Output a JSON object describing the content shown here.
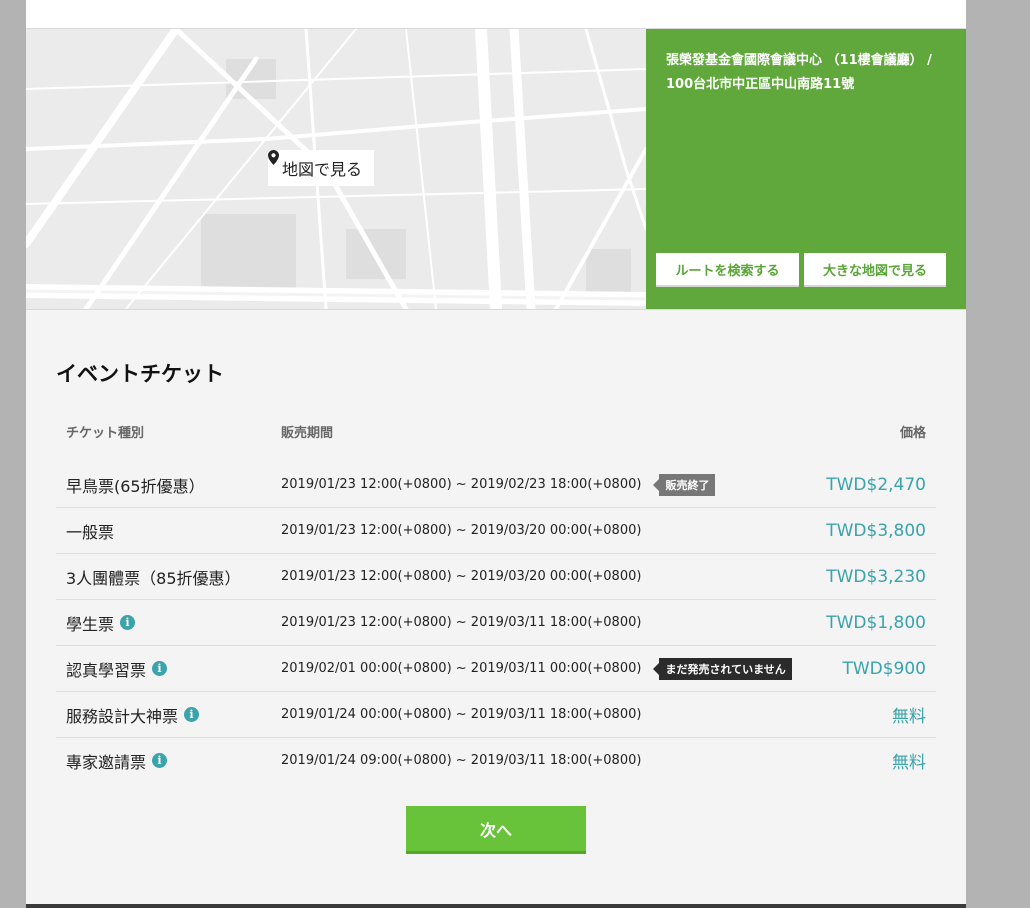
{
  "map": {
    "view_label": "地図で見る",
    "pin_icon": "map-pin-icon"
  },
  "venue": {
    "address": "張榮發基金會國際會議中心 （11樓會議廳） / 100台北市中正區中山南路11號",
    "route_button": "ルートを検索する",
    "large_map_button": "大きな地図で見る",
    "bg_color": "#60a83c"
  },
  "tickets": {
    "title": "イベントチケット",
    "headers": {
      "type": "チケット種別",
      "period": "販売期間",
      "price": "価格"
    },
    "rows": [
      {
        "name": "早鳥票(65折優惠）",
        "info": false,
        "period": "2019/01/23 12:00(+0800) ~ 2019/02/23 18:00(+0800)",
        "badge": "販売終了",
        "badge_style": "grey",
        "price": "TWD$2,470"
      },
      {
        "name": "一般票",
        "info": false,
        "period": "2019/01/23 12:00(+0800) ~ 2019/03/20 00:00(+0800)",
        "badge": "",
        "price": "TWD$3,800"
      },
      {
        "name": "3人團體票（85折優惠）",
        "info": false,
        "period": "2019/01/23 12:00(+0800) ~ 2019/03/20 00:00(+0800)",
        "badge": "",
        "price": "TWD$3,230"
      },
      {
        "name": "學生票",
        "info": true,
        "period": "2019/01/23 12:00(+0800) ~ 2019/03/11 18:00(+0800)",
        "badge": "",
        "price": "TWD$1,800"
      },
      {
        "name": "認真學習票",
        "info": true,
        "period": "2019/02/01 00:00(+0800) ~ 2019/03/11 00:00(+0800)",
        "badge": "まだ発売されていません",
        "badge_style": "dark",
        "price": "TWD$900"
      },
      {
        "name": "服務設計大神票",
        "info": true,
        "period": "2019/01/24 00:00(+0800) ~ 2019/03/11 18:00(+0800)",
        "badge": "",
        "price": "無料"
      },
      {
        "name": "專家邀請票",
        "info": true,
        "period": "2019/01/24 09:00(+0800) ~ 2019/03/11 18:00(+0800)",
        "badge": "",
        "price": "無料"
      }
    ],
    "info_icon": "info-icon",
    "price_color": "#3aa3ab"
  },
  "next_button": {
    "label": "次へ",
    "color": "#68c23a"
  }
}
